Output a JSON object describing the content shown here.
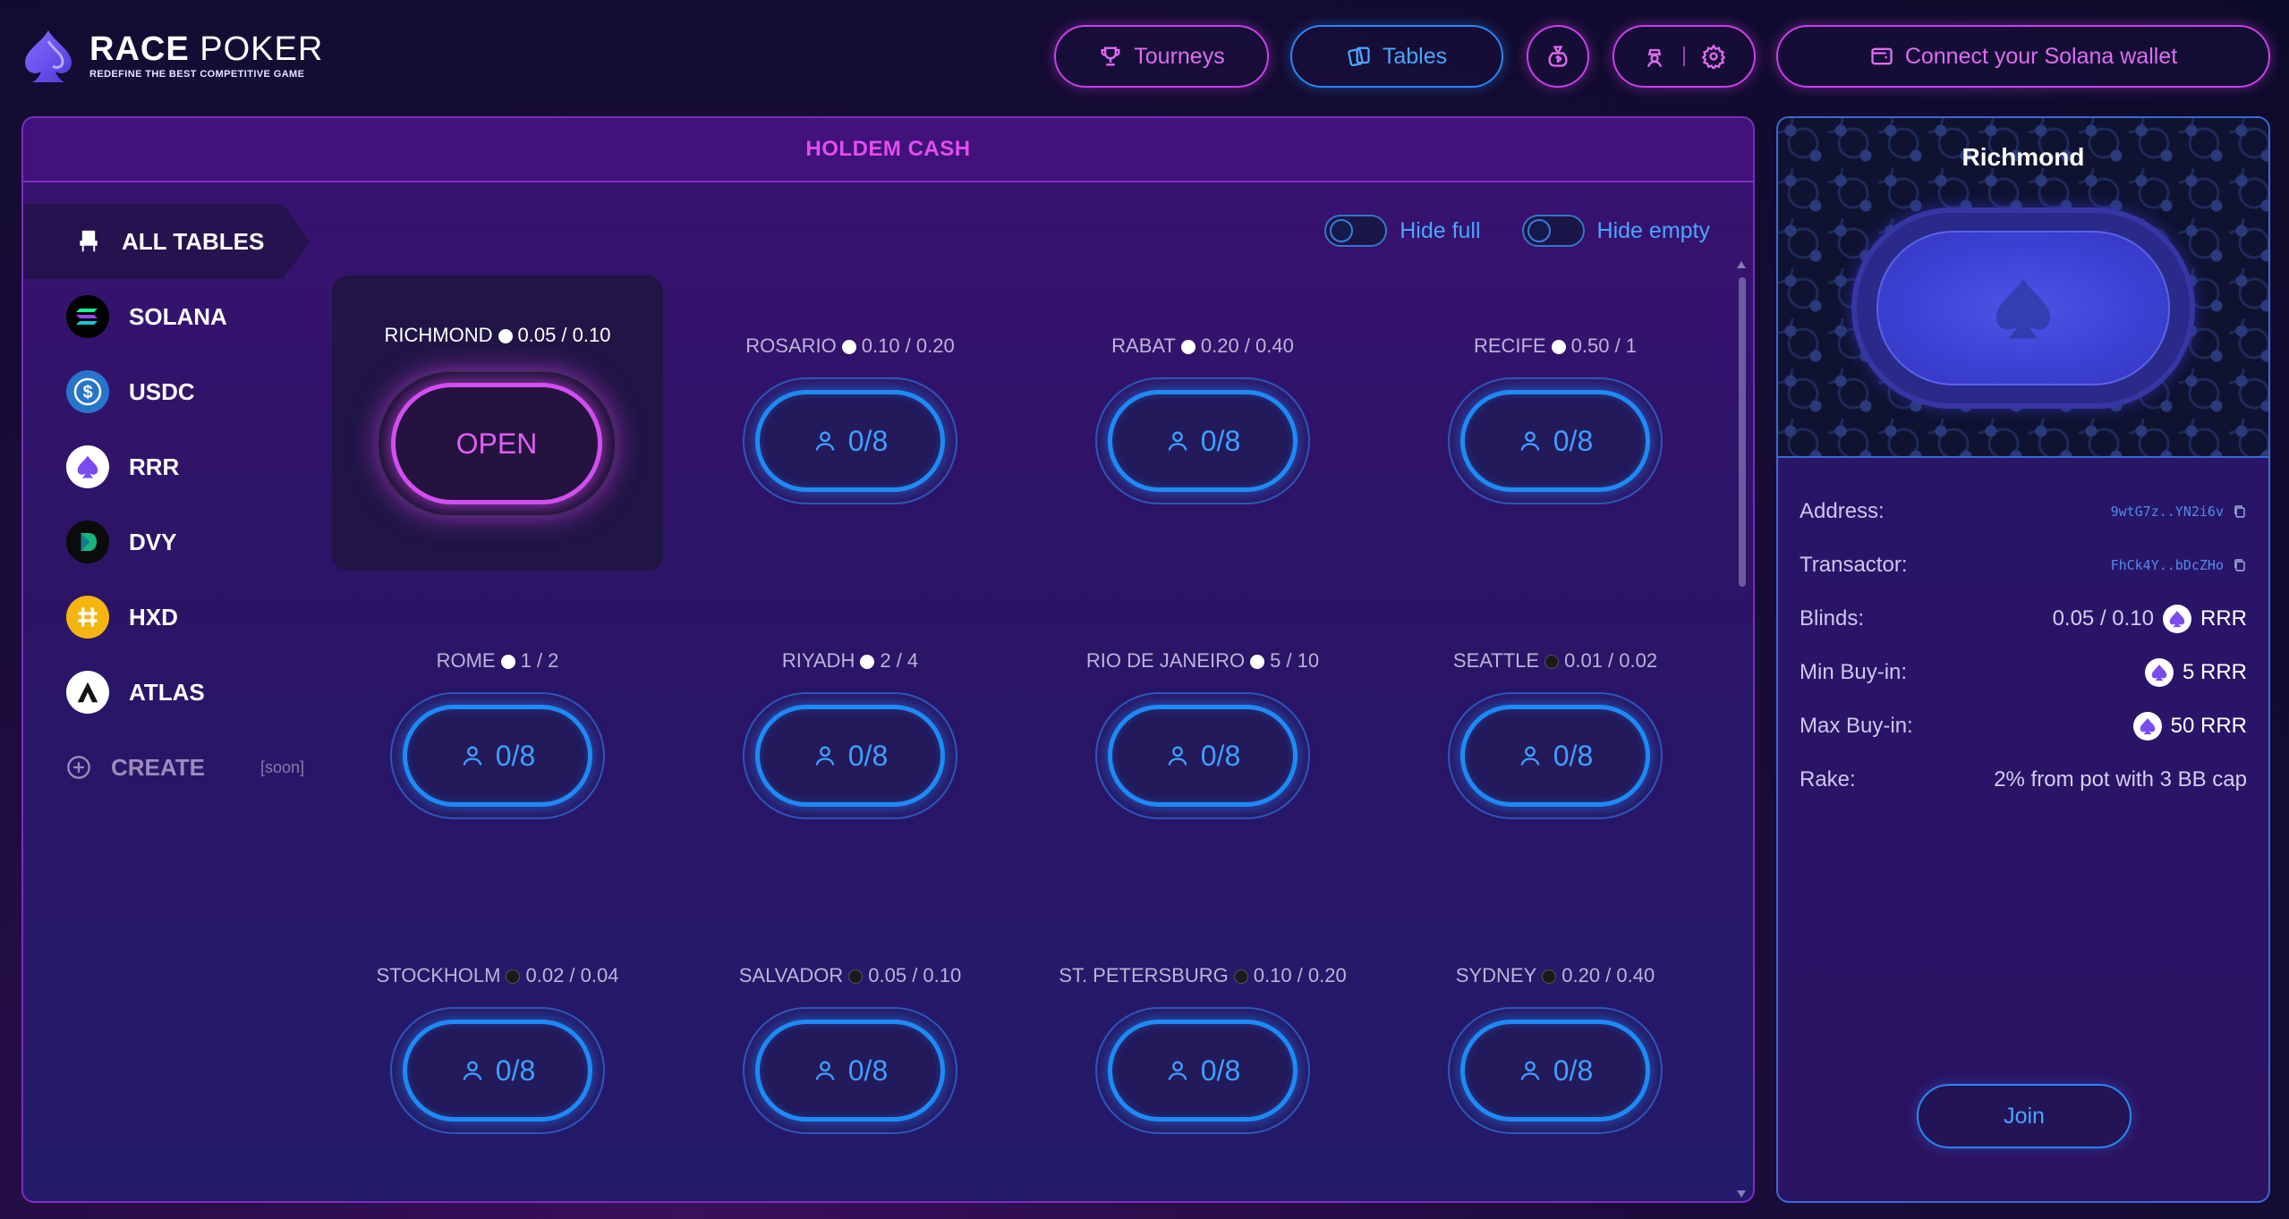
{
  "brand": {
    "name_bold": "RACE",
    "name_light": "POKER",
    "tagline": "REDEFINE THE BEST COMPETITIVE GAME"
  },
  "nav": {
    "tourneys": "Tourneys",
    "tables": "Tables",
    "connect_wallet": "Connect your Solana wallet"
  },
  "panel": {
    "title": "HOLDEM CASH"
  },
  "sidebar": {
    "items": [
      {
        "label": "ALL TABLES",
        "icon": "chair-icon"
      },
      {
        "label": "SOLANA",
        "icon": "solana-icon"
      },
      {
        "label": "USDC",
        "icon": "usdc-icon"
      },
      {
        "label": "RRR",
        "icon": "rrr-icon"
      },
      {
        "label": "DVY",
        "icon": "dvy-icon"
      },
      {
        "label": "HXD",
        "icon": "hxd-icon"
      },
      {
        "label": "ATLAS",
        "icon": "atlas-icon"
      }
    ],
    "create": {
      "label": "CREATE",
      "badge": "[soon]"
    }
  },
  "filters": {
    "hide_full": "Hide full",
    "hide_empty": "Hide empty"
  },
  "tables": [
    {
      "name": "RICHMOND",
      "blinds": "0.05 / 0.10",
      "coin": "rrr",
      "seats": "OPEN",
      "selected": true
    },
    {
      "name": "ROSARIO",
      "blinds": "0.10 / 0.20",
      "coin": "rrr",
      "seats": "0/8"
    },
    {
      "name": "RABAT",
      "blinds": "0.20 / 0.40",
      "coin": "rrr",
      "seats": "0/8"
    },
    {
      "name": "RECIFE",
      "blinds": "0.50 / 1",
      "coin": "rrr",
      "seats": "0/8"
    },
    {
      "name": "ROME",
      "blinds": "1 / 2",
      "coin": "rrr",
      "seats": "0/8"
    },
    {
      "name": "RIYADH",
      "blinds": "2 / 4",
      "coin": "rrr",
      "seats": "0/8"
    },
    {
      "name": "RIO DE JANEIRO",
      "blinds": "5 / 10",
      "coin": "rrr",
      "seats": "0/8"
    },
    {
      "name": "SEATTLE",
      "blinds": "0.01 / 0.02",
      "coin": "sol",
      "seats": "0/8"
    },
    {
      "name": "STOCKHOLM",
      "blinds": "0.02 / 0.04",
      "coin": "sol",
      "seats": "0/8"
    },
    {
      "name": "SALVADOR",
      "blinds": "0.05 / 0.10",
      "coin": "sol",
      "seats": "0/8"
    },
    {
      "name": "ST. PETERSBURG",
      "blinds": "0.10 / 0.20",
      "coin": "sol",
      "seats": "0/8"
    },
    {
      "name": "SYDNEY",
      "blinds": "0.20 / 0.40",
      "coin": "sol",
      "seats": "0/8"
    }
  ],
  "detail": {
    "name": "Richmond",
    "address_label": "Address:",
    "address": "9wtG7z..YN2i6v",
    "transactor_label": "Transactor:",
    "transactor": "FhCk4Y..bDcZHo",
    "blinds_label": "Blinds:",
    "blinds": "0.05 / 0.10",
    "blinds_token": "RRR",
    "min_label": "Min Buy-in:",
    "min_buyin": "5 RRR",
    "max_label": "Max Buy-in:",
    "max_buyin": "50 RRR",
    "rake_label": "Rake:",
    "rake": "2% from pot with 3 BB cap",
    "join": "Join"
  },
  "colors": {
    "accent_pink": "#c940e6",
    "accent_blue": "#2b86f0",
    "background": "#1a0c3a"
  }
}
